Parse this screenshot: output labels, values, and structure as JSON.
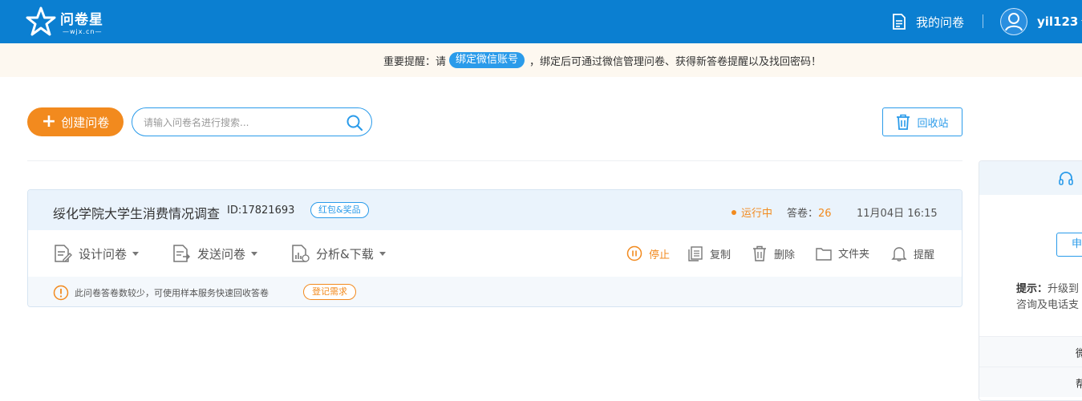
{
  "header": {
    "logo_text": "问卷星",
    "logo_sub": "—wjx.cn—",
    "my_surveys": "我的问卷",
    "username": "yil123"
  },
  "notice": {
    "prefix": "重要提醒：请",
    "bind_button": "绑定微信账号",
    "suffix": "，绑定后可通过微信管理问卷、获得新答卷提醒以及找回密码！"
  },
  "toolbar": {
    "create_label": "创建问卷",
    "search_placeholder": "请输入问卷名进行搜索...",
    "recycle_label": "回收站"
  },
  "survey": {
    "title": "绥化学院大学生消费情况调查",
    "id": "ID:17821693",
    "tag": "红包&奖品",
    "status": "运行中",
    "answers_label": "答卷：",
    "answers_count": "26",
    "date": "11月04日  16:15",
    "actions": {
      "design": "设计问卷",
      "send": "发送问卷",
      "analyze": "分析&下载",
      "stop": "停止",
      "copy": "复制",
      "delete": "删除",
      "folder": "文件夹",
      "remind": "提醒"
    },
    "footer_text": "此问卷答卷数较少，可使用样本服务快速回收答卷",
    "footer_button": "登记需求"
  },
  "side_panel": {
    "button_partial": "申",
    "tip_label": "提示：",
    "tip_line1": "升级到",
    "tip_line2": "咨询及电话支",
    "row1": "微",
    "row2": "帮"
  },
  "colors": {
    "brand_blue": "#0b7fd1",
    "accent_orange": "#f28a1e",
    "link_blue": "#2a9bea"
  }
}
